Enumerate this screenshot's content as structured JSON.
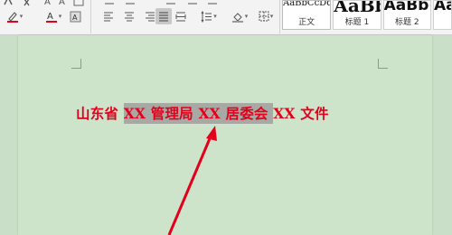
{
  "toolbar": {
    "row1_icons": [
      "unordered-list-icon",
      "numbered-list-icon",
      "decrease-indent-icon",
      "increase-indent-icon",
      "sort-icon",
      "show-marks-icon"
    ],
    "font_color": "#e3001b",
    "highlight_color": "#e3001b"
  },
  "styles": [
    {
      "preview": "AaBbCcDd",
      "label": "正文"
    },
    {
      "preview": "AaBb",
      "label": "标题 1"
    },
    {
      "preview": "AaBb(",
      "label": "标题 2"
    },
    {
      "preview": "AaB",
      "label": ""
    }
  ],
  "document": {
    "heading_parts": [
      "山东省 ",
      "XX 管理局 ",
      "XX 居委会 ",
      "XX 文件"
    ]
  }
}
